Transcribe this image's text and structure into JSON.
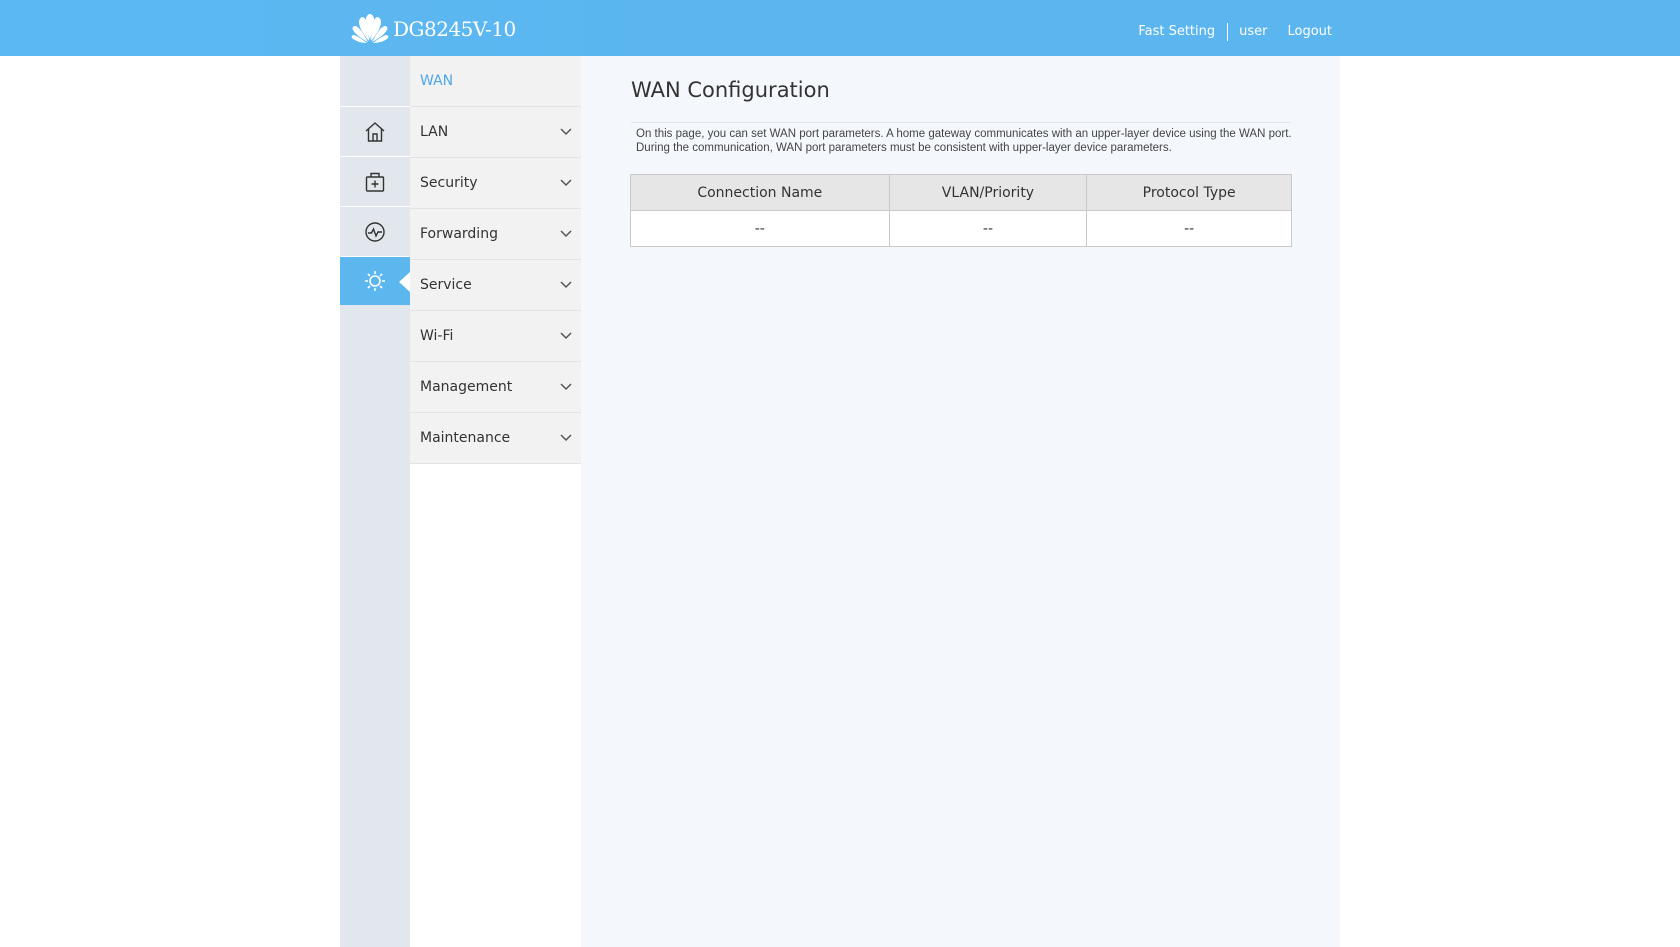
{
  "header": {
    "model": "DG8245V-10",
    "links": [
      "Fast Setting",
      "user",
      "Logout"
    ]
  },
  "rail": {
    "icons": [
      "home-icon",
      "add-box-icon",
      "monitor-pulse-icon",
      "gear-icon"
    ],
    "active": "gear-icon"
  },
  "menu": {
    "items": [
      {
        "label": "WAN",
        "current": true
      },
      {
        "label": "LAN"
      },
      {
        "label": "Security"
      },
      {
        "label": "Forwarding"
      },
      {
        "label": "Service"
      },
      {
        "label": "Wi-Fi"
      },
      {
        "label": "Management"
      },
      {
        "label": "Maintenance"
      }
    ]
  },
  "main": {
    "title": "WAN Configuration",
    "description": "On this page, you can set WAN port parameters. A home gateway communicates with an upper-layer device using the WAN port. During the communication, WAN port parameters must be consistent with upper-layer device parameters.",
    "table": {
      "headers": [
        "Connection Name",
        "VLAN/Priority",
        "Protocol Type"
      ],
      "rows": [
        [
          "--",
          "--",
          "--"
        ]
      ]
    }
  },
  "colors": {
    "header_blue": "#5cb7ef",
    "active_text": "#4ea8e6",
    "rail_bg": "#e1e7ec",
    "content_bg": "#f4f8fc"
  }
}
